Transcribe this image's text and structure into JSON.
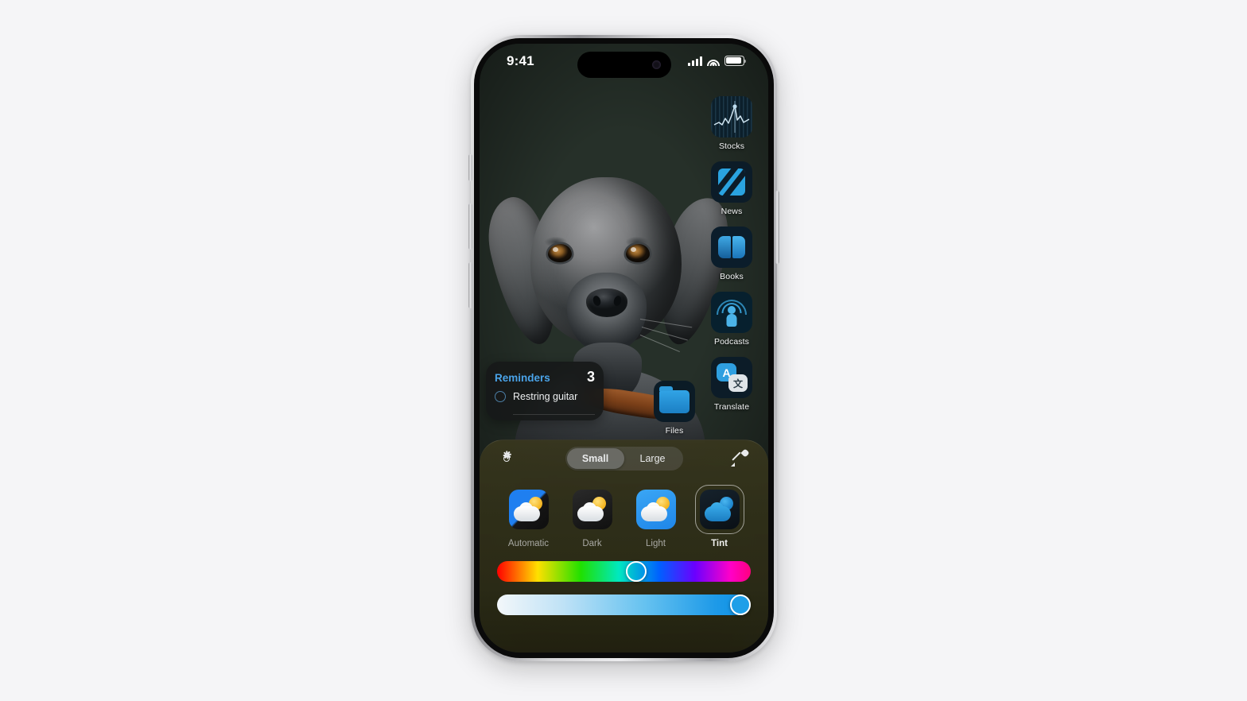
{
  "page": {
    "background_color": "#f5f5f7"
  },
  "device": {
    "name": "iPhone",
    "frame_color": "#c9c9cb",
    "buttons": [
      "action-button",
      "volume-up-button",
      "volume-down-button",
      "power-button"
    ]
  },
  "status_bar": {
    "time": "9:41",
    "cellular_icon": "cellular-signal-icon",
    "wifi_icon": "wifi-icon",
    "battery_icon": "battery-icon",
    "dynamic_island": "dynamic-island"
  },
  "home_screen": {
    "wallpaper_subject": "dog",
    "apps": [
      {
        "label": "Stocks",
        "icon": "stocks-icon"
      },
      {
        "label": "News",
        "icon": "news-icon"
      },
      {
        "label": "Books",
        "icon": "books-icon"
      },
      {
        "label": "Podcasts",
        "icon": "podcasts-icon"
      },
      {
        "label": "Translate",
        "icon": "translate-icon"
      }
    ],
    "dock_apps": [
      {
        "label": "Files",
        "icon": "files-icon"
      }
    ],
    "widget": {
      "title": "Reminders",
      "count": "3",
      "task": "Restring guitar",
      "title_color": "#4aa3e8"
    }
  },
  "customize_sheet": {
    "brightness_icon": "brightness-sun-icon",
    "eyedropper_icon": "eyedropper-icon",
    "size_segment": {
      "options": [
        "Small",
        "Large"
      ],
      "selected": "Small"
    },
    "appearance_modes": [
      {
        "label": "Automatic",
        "icon": "weather-icon-automatic",
        "selected": false
      },
      {
        "label": "Dark",
        "icon": "weather-icon-dark",
        "selected": false
      },
      {
        "label": "Light",
        "icon": "weather-icon-light",
        "selected": false
      },
      {
        "label": "Tint",
        "icon": "weather-icon-tint",
        "selected": true
      }
    ],
    "hue_slider": {
      "name": "hue-slider",
      "value_percent": 55,
      "handle_color": "#ffffff"
    },
    "saturation_slider": {
      "name": "saturation-slider",
      "value_percent": 96,
      "handle_color": "#1e9fe8"
    }
  }
}
